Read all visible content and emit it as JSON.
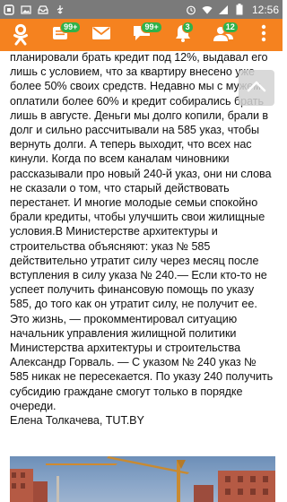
{
  "status_bar": {
    "time": "12:56",
    "icons": [
      "notification-icon",
      "photo-icon",
      "inbox-icon",
      "usb-icon",
      "alarm-icon",
      "wifi-icon",
      "signal-icon",
      "battery-icon"
    ]
  },
  "app_bar": {
    "logo": "odnoklassniki-logo-icon",
    "items": [
      {
        "icon": "feed-icon",
        "badge": "99+"
      },
      {
        "icon": "messages-icon",
        "badge": ""
      },
      {
        "icon": "discussions-icon",
        "badge": "99+"
      },
      {
        "icon": "notifications-icon",
        "badge": "3"
      },
      {
        "icon": "friends-icon",
        "badge": "12"
      }
    ],
    "accent_color": "#f5821f",
    "badge_color": "#2fb24a"
  },
  "article": {
    "paragraphs": [
      "планировали брать кредит под 12%, выдавал его лишь с условием, что за квартиру внесено уже более 50% своих средств. Недавно мы с мужем оплатили более 60% и кредит собирались брать лишь в августе. Деньги мы долго копили, брали в долг и сильно рассчитывали на 585 указ, чтобы вернуть долги. А теперь выходит, что всех нас кинули. Когда по всем каналам чиновники рассказывали про новый 240-й указ, они ни слова не сказали о том, что старый действовать перестанет. И многие молодые семьи спокойно брали кредиты, чтобы улучшить свои жилищные условия.В Министерстве архитектуры и строительства объясняют: указ № 585 действительно утратит силу через месяц после вступления в силу указа № 240.— Если кто-то не успеет получить финансовую помощь по указу 585, до того как он утратит силу, не получит ее. Это жизнь, — прокомментировал ситуацию начальник управления жилищной политики Министерства архитектуры и строительства Александр Горваль. — С указом № 240 указ № 585 никак не пересекается. По указу 240 получить субсидию граждане смогут только в порядке очереди."
    ],
    "byline": "Елена Толкачева, TUT.BY"
  },
  "scroll_up_icon": "chevron-up-icon"
}
